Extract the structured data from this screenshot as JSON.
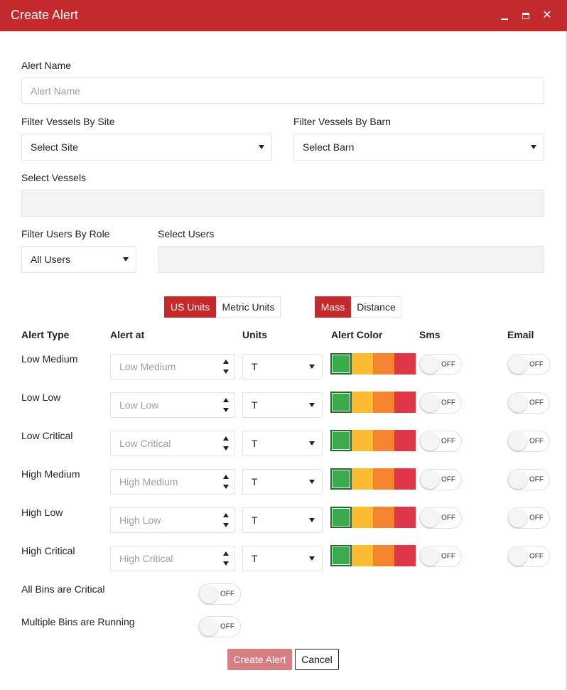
{
  "window": {
    "title": "Create Alert"
  },
  "form": {
    "alert_name_label": "Alert Name",
    "alert_name_placeholder": "Alert Name",
    "filter_site_label": "Filter Vessels By Site",
    "site_selected": "Select Site",
    "filter_barn_label": "Filter Vessels By Barn",
    "barn_selected": "Select Barn",
    "select_vessels_label": "Select Vessels",
    "filter_role_label": "Filter Users By Role",
    "role_selected": "All Users",
    "select_users_label": "Select Users"
  },
  "unit_system": {
    "options": [
      "US Units",
      "Metric Units"
    ],
    "selected": "US Units"
  },
  "measure_type": {
    "options": [
      "Mass",
      "Distance"
    ],
    "selected": "Mass"
  },
  "table": {
    "headers": {
      "alert_type": "Alert Type",
      "alert_at": "Alert at",
      "units": "Units",
      "alert_color": "Alert Color",
      "sms": "Sms",
      "email": "Email"
    },
    "rows": [
      {
        "type": "Low Medium",
        "placeholder": "Low Medium",
        "unit": "T",
        "sms": "OFF",
        "email": "OFF"
      },
      {
        "type": "Low Low",
        "placeholder": "Low Low",
        "unit": "T",
        "sms": "OFF",
        "email": "OFF"
      },
      {
        "type": "Low Critical",
        "placeholder": "Low Critical",
        "unit": "T",
        "sms": "OFF",
        "email": "OFF"
      },
      {
        "type": "High Medium",
        "placeholder": "High Medium",
        "unit": "T",
        "sms": "OFF",
        "email": "OFF"
      },
      {
        "type": "High Low",
        "placeholder": "High Low",
        "unit": "T",
        "sms": "OFF",
        "email": "OFF"
      },
      {
        "type": "High Critical",
        "placeholder": "High Critical",
        "unit": "T",
        "sms": "OFF",
        "email": "OFF"
      }
    ],
    "colors": [
      "#3aaa4a",
      "#fbbc33",
      "#f6832f",
      "#df3747"
    ],
    "selected_color_index": 0
  },
  "extra_toggles": [
    {
      "label": "All Bins are Critical",
      "state": "OFF"
    },
    {
      "label": "Multiple Bins are Running",
      "state": "OFF"
    }
  ],
  "actions": {
    "create_label": "Create Alert",
    "cancel_label": "Cancel"
  },
  "theme": {
    "accent": "#c4292c"
  }
}
